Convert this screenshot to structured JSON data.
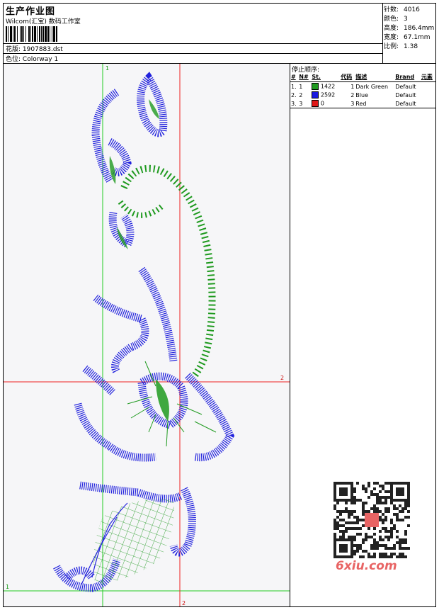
{
  "header": {
    "title": "生产作业图",
    "company": "Wilcom(汇宝) 数码工作室",
    "pattern_label": "花版:",
    "pattern_value": "1907883.dst",
    "color_label": "色位:",
    "color_value": "Colorway 1"
  },
  "stats": [
    {
      "label": "针数:",
      "value": "4016"
    },
    {
      "label": "颜色:",
      "value": "3"
    },
    {
      "label": "高度:",
      "value": "186.4mm"
    },
    {
      "label": "宽度:",
      "value": "67.1mm"
    },
    {
      "label": "比例:",
      "value": "1.38"
    }
  ],
  "stop_sequence": {
    "title": "停止顺序:",
    "columns": [
      "#",
      "N#",
      "St.",
      "代码",
      "描述",
      "Brand",
      "元素"
    ],
    "rows": [
      {
        "idx": "1.",
        "n": "1",
        "color": "#1f9a1f",
        "st": "1422",
        "code": "1",
        "desc": "Dark Green",
        "brand": "Default",
        "element": ""
      },
      {
        "idx": "2.",
        "n": "2",
        "color": "#1a1ae0",
        "st": "2592",
        "code": "2",
        "desc": "Blue",
        "brand": "Default",
        "element": ""
      },
      {
        "idx": "3.",
        "n": "3",
        "color": "#e01818",
        "st": "0",
        "code": "3",
        "desc": "Red",
        "brand": "Default",
        "element": ""
      }
    ]
  },
  "guides": {
    "vertical_green_label": "1",
    "horizontal_green_label": "1",
    "horizontal_red_label": "2",
    "vertical_red_label": "2"
  },
  "colors": {
    "green_guide": "#22cc22",
    "red_guide": "#ee2222",
    "stitch_blue": "#2222dd",
    "stitch_green": "#1f9a1f"
  },
  "watermark": {
    "site": "6xiu.com"
  }
}
